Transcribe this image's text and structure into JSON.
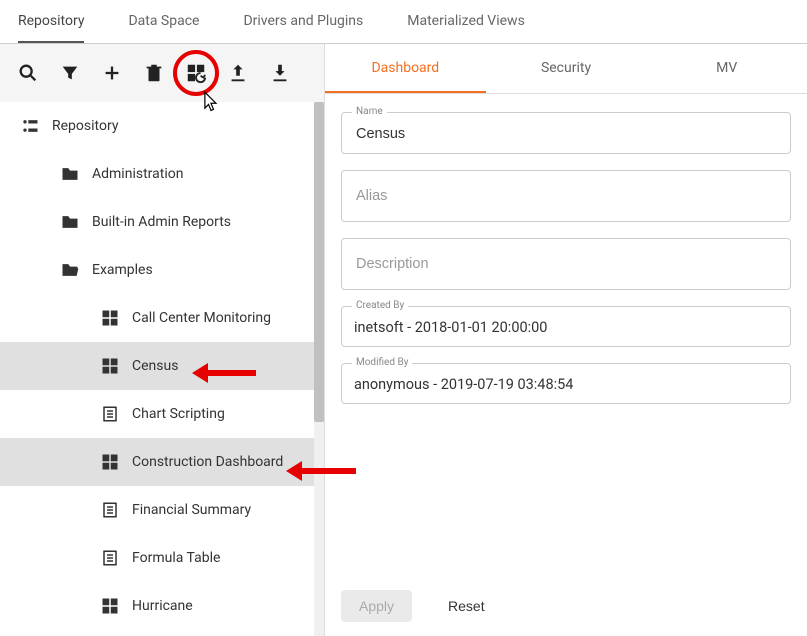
{
  "topTabs": {
    "repository": "Repository",
    "dataSpace": "Data Space",
    "drivers": "Drivers and Plugins",
    "matViews": "Materialized Views"
  },
  "tree": {
    "root": "Repository",
    "items": [
      {
        "label": "Administration",
        "icon": "folder"
      },
      {
        "label": "Built-in Admin Reports",
        "icon": "folder"
      },
      {
        "label": "Examples",
        "icon": "folder-open"
      },
      {
        "label": "Call Center Monitoring",
        "icon": "dashboard",
        "child": true
      },
      {
        "label": "Census",
        "icon": "dashboard",
        "child": true,
        "selected": true
      },
      {
        "label": "Chart Scripting",
        "icon": "worksheet",
        "child": true
      },
      {
        "label": "Construction Dashboard",
        "icon": "dashboard",
        "child": true,
        "selected": true
      },
      {
        "label": "Financial Summary",
        "icon": "worksheet",
        "child": true
      },
      {
        "label": "Formula Table",
        "icon": "worksheet",
        "child": true
      },
      {
        "label": "Hurricane",
        "icon": "dashboard",
        "child": true
      }
    ]
  },
  "detailTabs": {
    "dashboard": "Dashboard",
    "security": "Security",
    "mv": "MV"
  },
  "fields": {
    "nameLabel": "Name",
    "name": "Census",
    "aliasPlaceholder": "Alias",
    "descPlaceholder": "Description",
    "createdByLabel": "Created By",
    "createdBy": "inetsoft - 2018-01-01 20:00:00",
    "modifiedByLabel": "Modified By",
    "modifiedBy": "anonymous - 2019-07-19 03:48:54"
  },
  "actions": {
    "apply": "Apply",
    "reset": "Reset"
  }
}
